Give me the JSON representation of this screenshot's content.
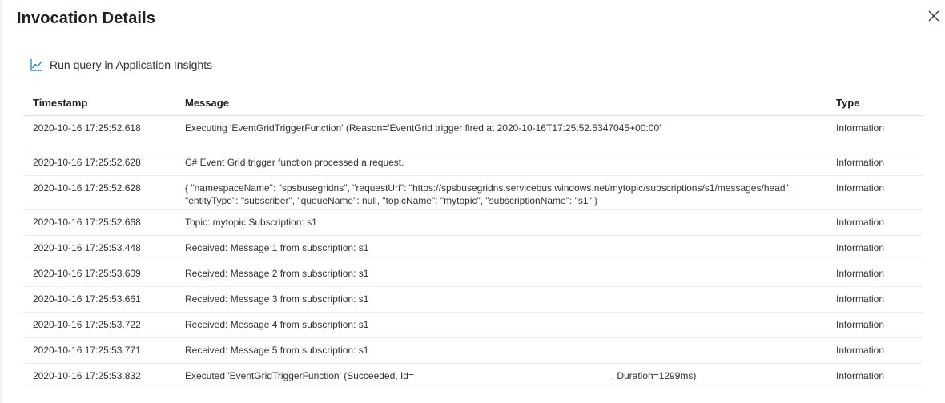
{
  "dialog": {
    "title": "Invocation Details",
    "close_icon": "close-icon"
  },
  "toolbar": {
    "run_query_label": "Run query in Application Insights",
    "run_query_icon": "line-chart-icon"
  },
  "table": {
    "columns": [
      "Timestamp",
      "Message",
      "Type"
    ],
    "rows": [
      {
        "timestamp": "2020-10-16 17:25:52.618",
        "message": "Executing 'EventGridTriggerFunction' (Reason='EventGrid trigger fired at 2020-10-16T17:25:52.5347045+00:00'",
        "type": "Information"
      },
      {
        "timestamp": "2020-10-16 17:25:52.628",
        "message": "C# Event Grid trigger function processed a request.",
        "type": "Information"
      },
      {
        "timestamp": "2020-10-16 17:25:52.628",
        "message": "{ \"namespaceName\": \"spsbusegridns\", \"requestUri\": \"https://spsbusegridns.servicebus.windows.net/mytopic/subscriptions/s1/messages/head\", \"entityType\": \"subscriber\", \"queueName\": null, \"topicName\": \"mytopic\", \"subscriptionName\": \"s1\" }",
        "type": "Information"
      },
      {
        "timestamp": "2020-10-16 17:25:52.668",
        "message": "Topic: mytopic Subscription: s1",
        "type": "Information"
      },
      {
        "timestamp": "2020-10-16 17:25:53.448",
        "message": "Received: Message 1 from subscription: s1",
        "type": "Information"
      },
      {
        "timestamp": "2020-10-16 17:25:53.609",
        "message": "Received: Message 2 from subscription: s1",
        "type": "Information"
      },
      {
        "timestamp": "2020-10-16 17:25:53.661",
        "message": "Received: Message 3 from subscription: s1",
        "type": "Information"
      },
      {
        "timestamp": "2020-10-16 17:25:53.722",
        "message": "Received: Message 4 from subscription: s1",
        "type": "Information"
      },
      {
        "timestamp": "2020-10-16 17:25:53.771",
        "message": "Received: Message 5 from subscription: s1",
        "type": "Information"
      },
      {
        "timestamp": "2020-10-16 17:25:53.832",
        "message": "Executed 'EventGridTriggerFunction' (Succeeded, Id=                                                                          , Duration=1299ms)",
        "type": "Information"
      }
    ]
  },
  "colors": {
    "accent": "#0078d4",
    "text": "#323130",
    "divider": "#edebe9"
  }
}
